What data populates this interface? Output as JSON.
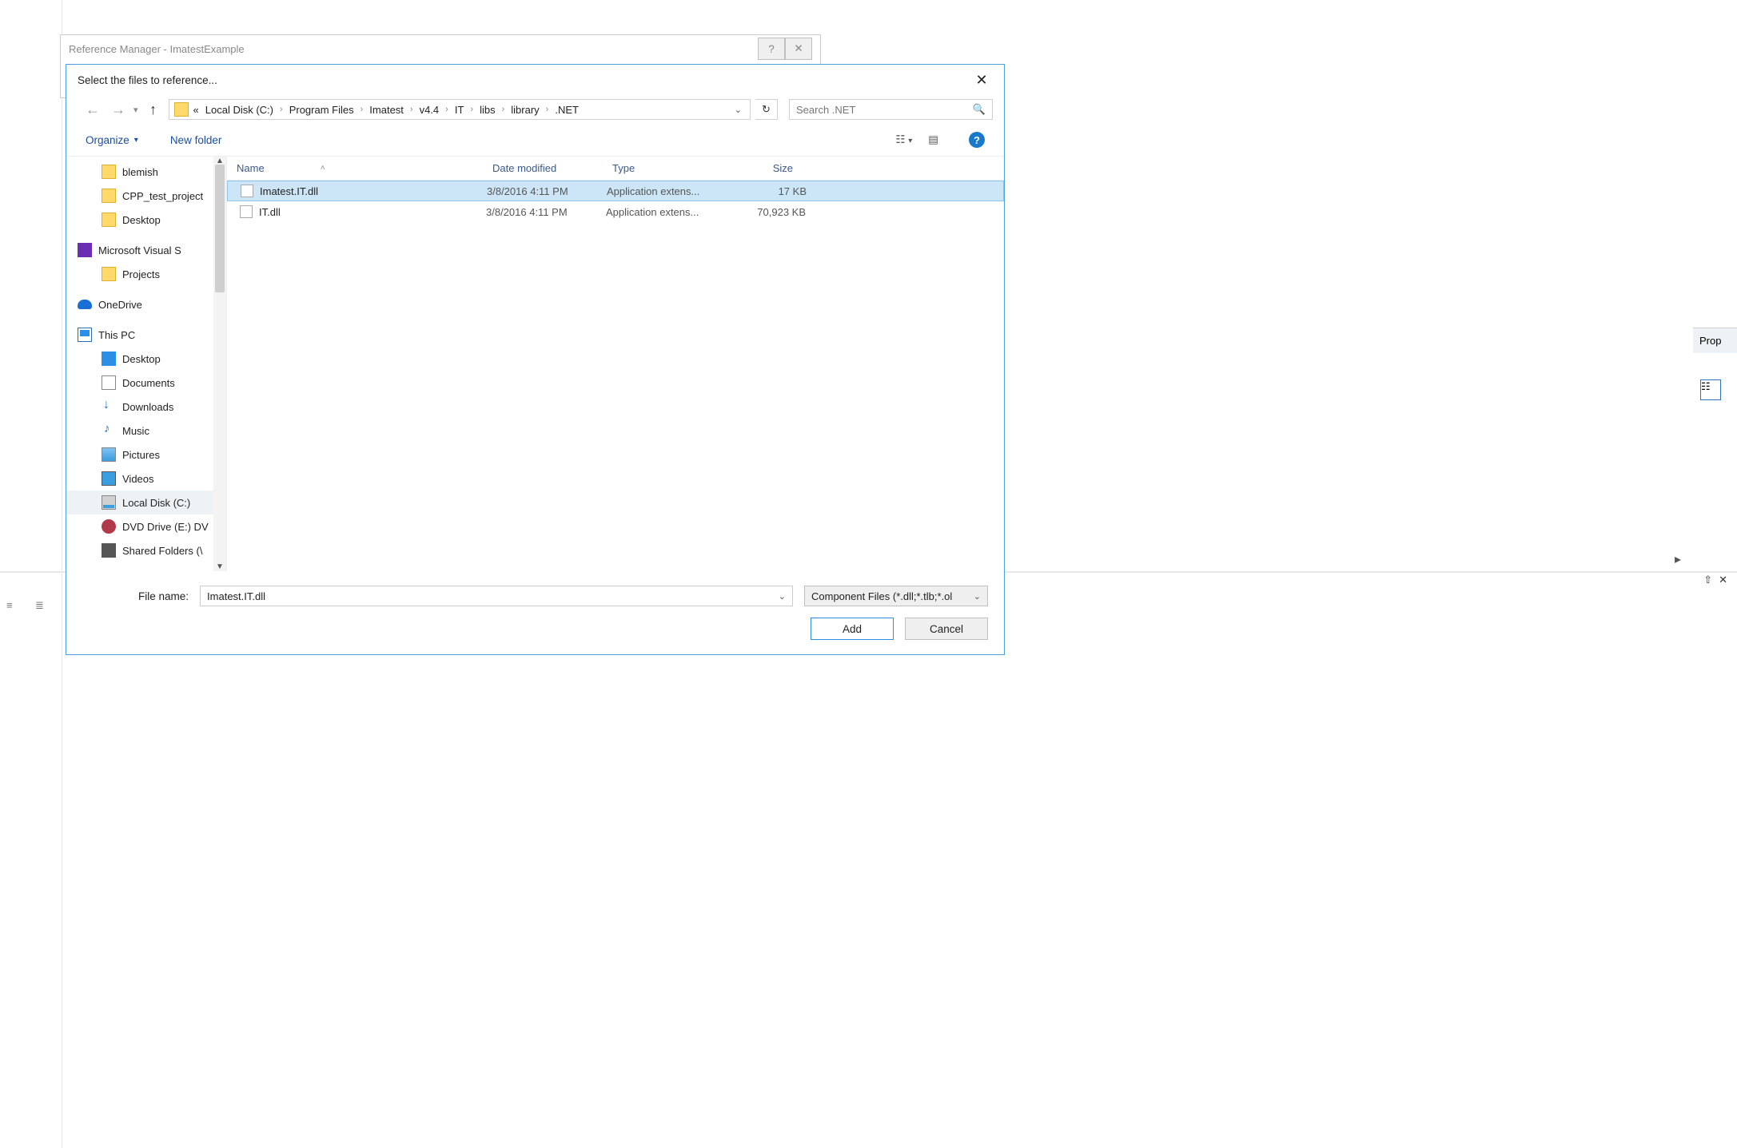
{
  "parent_window": {
    "title": "Reference Manager - ImatestExample",
    "help": "?",
    "close": "✕"
  },
  "dialog": {
    "title": "Select the files to reference...",
    "nav": {
      "back": "←",
      "forward": "→",
      "up": "↑",
      "prefix": "«",
      "crumbs": [
        "Local Disk (C:)",
        "Program Files",
        "Imatest",
        "v4.4",
        "IT",
        "libs",
        "library",
        ".NET"
      ],
      "refresh": "↻"
    },
    "search": {
      "placeholder": "Search .NET"
    },
    "toolbar": {
      "organize": "Organize",
      "organize_caret": "▾",
      "newfolder": "New folder",
      "view1": "☷",
      "view_caret": "▾",
      "view2": "▤",
      "help": "?"
    },
    "tree": [
      {
        "cls": "d1",
        "icon": "folder",
        "label": "blemish"
      },
      {
        "cls": "d1",
        "icon": "folder",
        "label": "CPP_test_project"
      },
      {
        "cls": "d1",
        "icon": "folder",
        "label": "Desktop"
      },
      {
        "cls": "group",
        "icon": "vs",
        "label": "Microsoft Visual S"
      },
      {
        "cls": "d1",
        "icon": "folder",
        "label": "Projects"
      },
      {
        "cls": "group",
        "icon": "od",
        "label": "OneDrive"
      },
      {
        "cls": "group",
        "icon": "pc",
        "label": "This PC"
      },
      {
        "cls": "d1",
        "icon": "desk",
        "label": "Desktop"
      },
      {
        "cls": "d1",
        "icon": "doc",
        "label": "Documents"
      },
      {
        "cls": "d1",
        "icon": "dl",
        "label": "Downloads"
      },
      {
        "cls": "d1",
        "icon": "mus",
        "label": "Music"
      },
      {
        "cls": "d1",
        "icon": "pic",
        "label": "Pictures"
      },
      {
        "cls": "d1",
        "icon": "vid",
        "label": "Videos"
      },
      {
        "cls": "d1 sel",
        "icon": "disk",
        "label": "Local Disk (C:)"
      },
      {
        "cls": "d1",
        "icon": "dvd",
        "label": "DVD Drive (E:) DV"
      },
      {
        "cls": "d1",
        "icon": "sf",
        "label": "Shared Folders (\\"
      }
    ],
    "columns": {
      "name": "Name",
      "date": "Date modified",
      "type": "Type",
      "size": "Size",
      "sort": "˄"
    },
    "rows": [
      {
        "sel": true,
        "name": "Imatest.IT.dll",
        "date": "3/8/2016 4:11 PM",
        "type": "Application extens...",
        "size": "17 KB"
      },
      {
        "sel": false,
        "name": "IT.dll",
        "date": "3/8/2016 4:11 PM",
        "type": "Application extens...",
        "size": "70,923 KB"
      }
    ],
    "filebar": {
      "label": "File name:",
      "value": "Imatest.IT.dll",
      "filter": "Component Files (*.dll;*.tlb;*.ol"
    },
    "buttons": {
      "add": "Add",
      "cancel": "Cancel"
    }
  },
  "backdrop": {
    "prop_tab": "Prop",
    "pin": "⇧",
    "close": "✕",
    "scroll_right": "▸",
    "scroll_down": "▾"
  }
}
